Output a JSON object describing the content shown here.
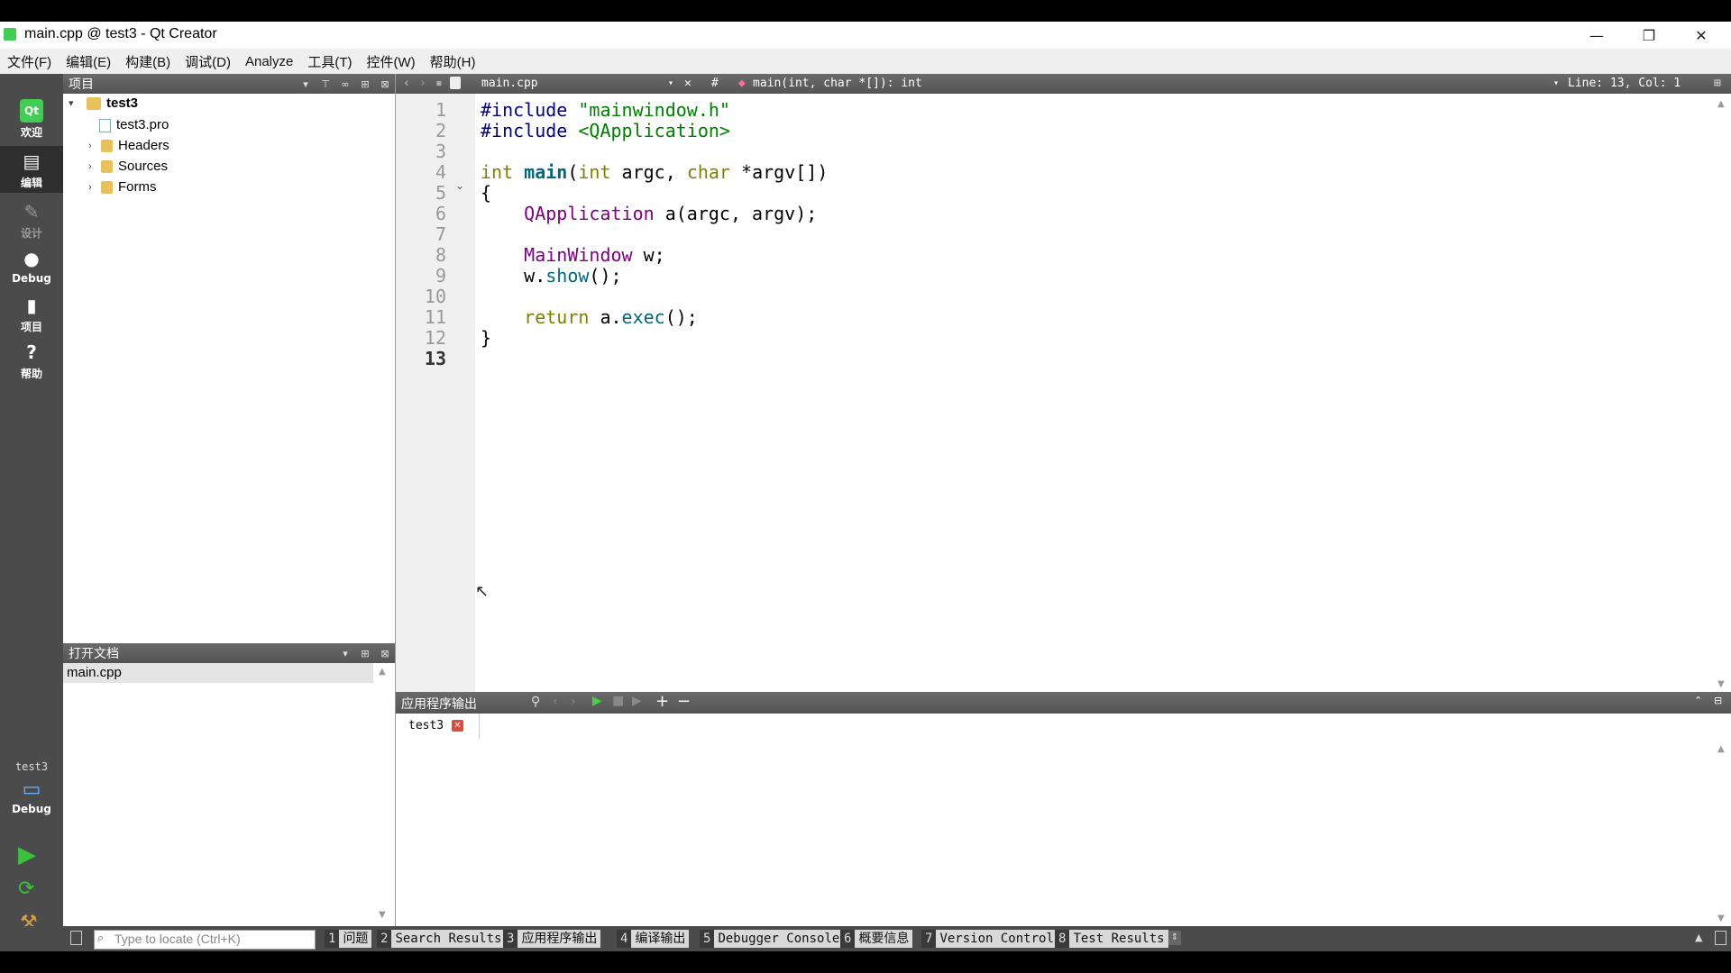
{
  "window": {
    "title": "main.cpp @ test3 - Qt Creator",
    "min_label": "—",
    "restore_label": "❐",
    "close_label": "✕"
  },
  "menubar": [
    "文件(F)",
    "编辑(E)",
    "构建(B)",
    "调试(D)",
    "Analyze",
    "工具(T)",
    "控件(W)",
    "帮助(H)"
  ],
  "modes": [
    {
      "label": "欢迎",
      "icon": "qt-logo-icon"
    },
    {
      "label": "编辑",
      "icon": "document-icon"
    },
    {
      "label": "设计",
      "icon": "design-icon"
    },
    {
      "label": "Debug",
      "icon": "debug-icon"
    },
    {
      "label": "项目",
      "icon": "project-icon"
    },
    {
      "label": "帮助",
      "icon": "help-icon"
    }
  ],
  "kit": {
    "project": "test3",
    "build": "Debug"
  },
  "project_pane": {
    "title": "项目",
    "tree": [
      {
        "label": "test3",
        "level": 0,
        "expanded": true,
        "bold": true
      },
      {
        "label": "test3.pro",
        "level": 1
      },
      {
        "label": "Headers",
        "level": 1
      },
      {
        "label": "Sources",
        "level": 1
      },
      {
        "label": "Forms",
        "level": 1
      }
    ]
  },
  "open_docs_pane": {
    "title": "打开文档",
    "items": [
      "main.cpp"
    ]
  },
  "editor_toolbar": {
    "file": "main.cpp",
    "hash": "#",
    "symbol": "main(int, char *[]): int",
    "position": "Line: 13, Col: 1"
  },
  "editor": {
    "current_line": 13,
    "lines": [
      "#include \"mainwindow.h\"",
      "#include <QApplication>",
      "",
      "int main(int argc, char *argv[])",
      "{",
      "    QApplication a(argc, argv);",
      "",
      "    MainWindow w;",
      "    w.show();",
      "",
      "    return a.exec();",
      "}",
      ""
    ]
  },
  "output_pane": {
    "title": "应用程序输出",
    "tab": "test3"
  },
  "statusbar": {
    "locator_placeholder": "Type to locate (Ctrl+K)",
    "buttons": [
      {
        "n": "1",
        "label": "问题"
      },
      {
        "n": "2",
        "label": "Search Results"
      },
      {
        "n": "3",
        "label": "应用程序输出"
      },
      {
        "n": "4",
        "label": "编译输出"
      },
      {
        "n": "5",
        "label": "Debugger Console"
      },
      {
        "n": "6",
        "label": "概要信息"
      },
      {
        "n": "7",
        "label": "Version Control"
      },
      {
        "n": "8",
        "label": "Test Results"
      }
    ]
  }
}
